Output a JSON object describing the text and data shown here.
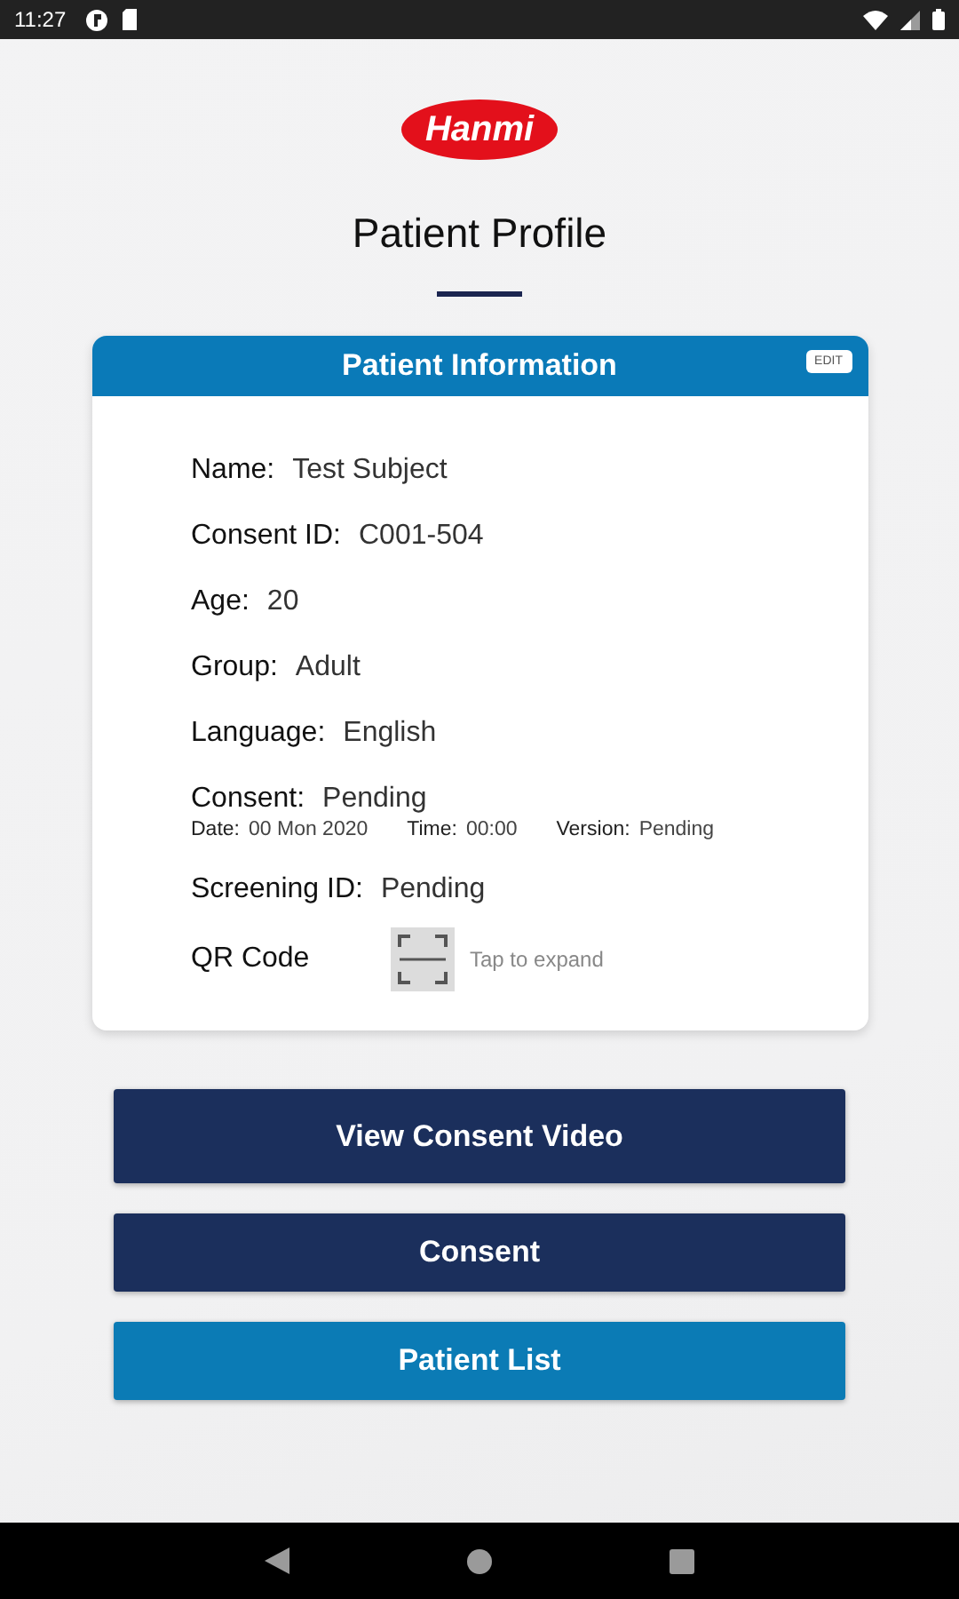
{
  "status_bar": {
    "time": "11:27"
  },
  "logo": {
    "text": "Hanmi"
  },
  "title": "Patient Profile",
  "card": {
    "title": "Patient Information",
    "edit_button": "EDIT",
    "rows": [
      {
        "kind": "text",
        "label": "Name:",
        "value": "Test Subject"
      },
      {
        "kind": "text",
        "label": "Consent ID:",
        "value": "C001-504"
      },
      {
        "kind": "text",
        "label": "Age:",
        "value": "20"
      },
      {
        "kind": "text",
        "label": "Group:",
        "value": "Adult"
      },
      {
        "kind": "text",
        "label": "Language:",
        "value": "English"
      },
      {
        "kind": "text",
        "label": "Consent:",
        "value": "Pending",
        "details": [
          {
            "label": "Date:",
            "value": "00 Mon 2020"
          },
          {
            "label": "Time:",
            "value": "00:00"
          },
          {
            "label": "Version:",
            "value": "Pending"
          }
        ]
      },
      {
        "kind": "text",
        "label": "Screening ID:",
        "value": "Pending"
      },
      {
        "kind": "qr",
        "label": "QR Code",
        "hint": "Tap to expand"
      }
    ]
  },
  "buttons": [
    {
      "label": "View Consent Video",
      "kind": "dark"
    },
    {
      "label": "Consent",
      "kind": "dark"
    },
    {
      "label": "Patient List",
      "kind": "blue"
    }
  ]
}
